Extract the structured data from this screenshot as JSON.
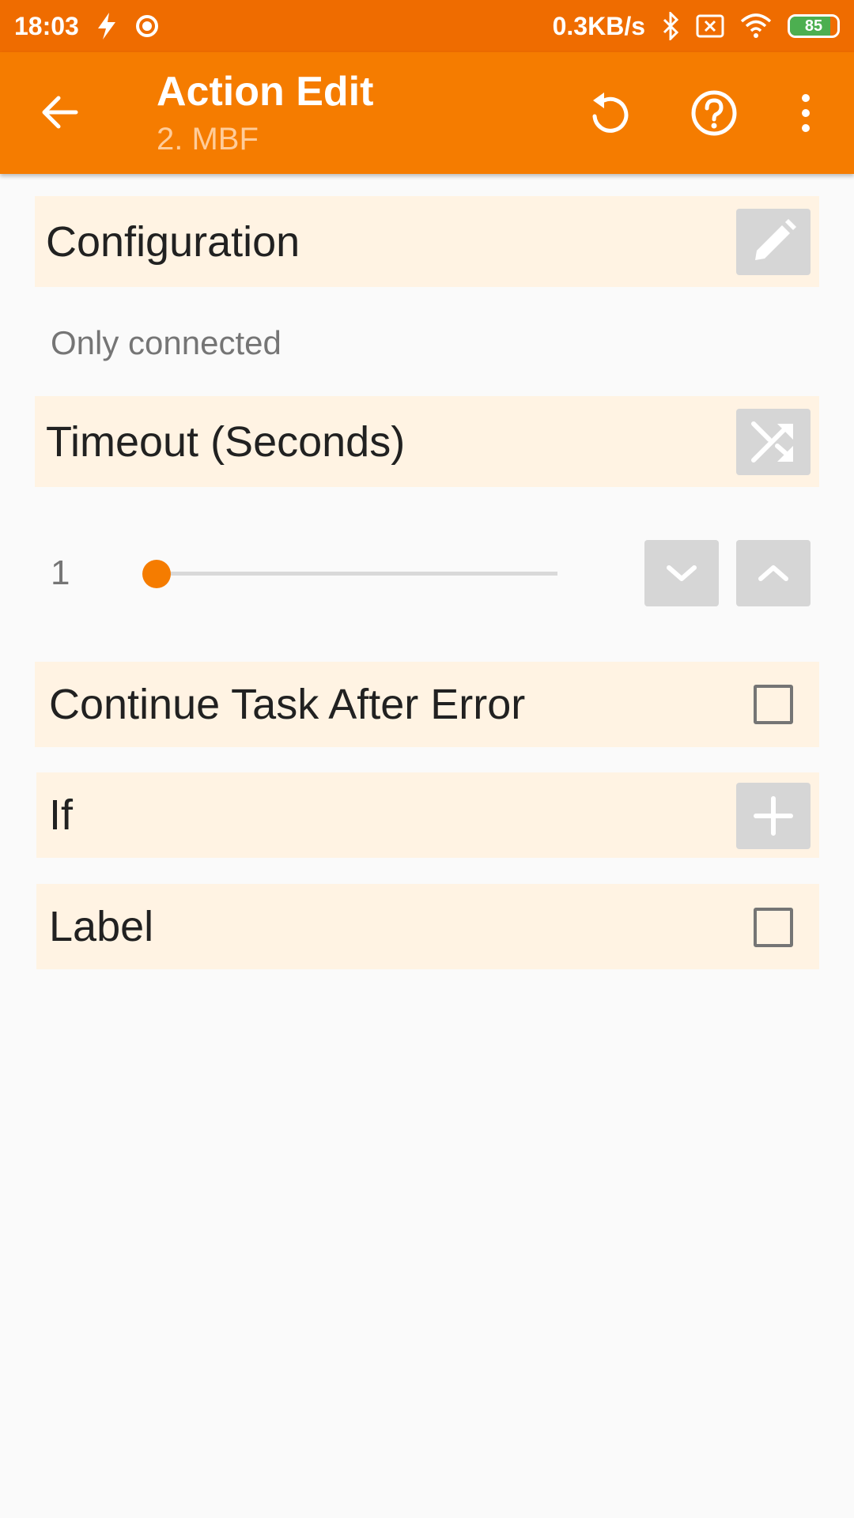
{
  "status_bar": {
    "time": "18:03",
    "network_speed": "0.3KB/s",
    "battery_level": "85",
    "battery_fraction": 0.85,
    "icons": [
      "flash-icon",
      "record-icon",
      "bluetooth-icon",
      "sim-error-icon",
      "wifi-icon",
      "battery-icon"
    ]
  },
  "app_bar": {
    "title": "Action Edit",
    "subtitle": "2. MBF",
    "icons": [
      "back-arrow-icon",
      "undo-icon",
      "help-icon",
      "overflow-menu-icon"
    ]
  },
  "configuration": {
    "label": "Configuration",
    "value": "Only connected",
    "button_icon": "pencil-icon"
  },
  "timeout": {
    "label": "Timeout (Seconds)",
    "button_icon": "shuffle-icon",
    "value": "1",
    "slider_fraction": 0.0,
    "decrement_icon": "chevron-down-icon",
    "increment_icon": "chevron-up-icon"
  },
  "continue_after_error": {
    "label": "Continue Task After Error",
    "checked": false
  },
  "if_condition": {
    "label": "If",
    "button_icon": "plus-icon"
  },
  "label_option": {
    "label": "Label",
    "checked": false
  },
  "colors": {
    "status_bar": "#ef6c00",
    "app_bar": "#f57c00",
    "section_bg": "#fff3e3",
    "button_gray": "#d6d6d6",
    "accent": "#f57c00"
  }
}
